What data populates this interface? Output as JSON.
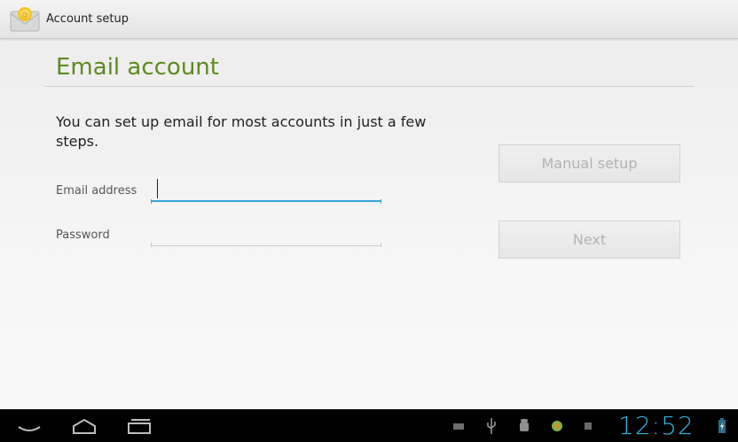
{
  "action_bar": {
    "title": "Account setup"
  },
  "page": {
    "title": "Email account",
    "intro": "You can set up email for most accounts in just a few steps."
  },
  "form": {
    "email_label": "Email address",
    "email_value": "",
    "password_label": "Password",
    "password_value": ""
  },
  "buttons": {
    "manual_setup": "Manual setup",
    "next": "Next"
  },
  "status_bar": {
    "time": "12:52",
    "icons": [
      "keyboard-icon",
      "usb-icon",
      "android-debug-icon",
      "app-notification-icon",
      "screenshot-icon",
      "battery-charging-icon"
    ]
  },
  "nav": {
    "icons": [
      "back-icon",
      "home-icon",
      "recent-apps-icon"
    ]
  },
  "colors": {
    "title_green": "#5c8a1e",
    "focus_blue": "#33a6d9",
    "clock_blue": "#33b5e5"
  }
}
